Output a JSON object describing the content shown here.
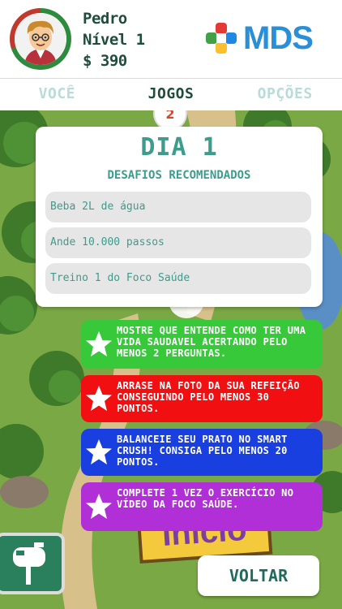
{
  "user": {
    "name": "Pedro",
    "level": "Nível 1",
    "money": "$ 390"
  },
  "brand": {
    "logo_text": "MDS"
  },
  "tabs": [
    {
      "label": "VOCÊ",
      "active": false
    },
    {
      "label": "JOGOS",
      "active": true
    },
    {
      "label": "OPÇÕES",
      "active": false
    }
  ],
  "day_card": {
    "title": "DIA 1",
    "subtitle": "DESAFIOS RECOMENDADOS",
    "challenges": [
      "Beba 2L de água",
      "Ande 10.000 passos",
      "Treino 1 do Foco Saúde"
    ]
  },
  "tasks": [
    {
      "text": "MOSTRE QUE ENTENDE COMO TER UMA VIDA SAUDAVEL ACERTANDO PELO MENOS 2 PERGUNTAS.",
      "color": "#37c93a"
    },
    {
      "text": "ARRASE NA FOTO DA SUA REFEIÇÃO CONSEGUINDO PELO MENOS 30 PONTOS.",
      "color": "#f20f12"
    },
    {
      "text": "BALANCEIE SEU PRATO NO SMART CRUSH! CONSIGA PELO MENOS 20 PONTOS.",
      "color": "#1a3fe0"
    },
    {
      "text": "COMPLETE 1 VEZ O EXERCÍCIO NO VÍDEO DA FOCO SAÚDE.",
      "color": "#b02fd6"
    }
  ],
  "map": {
    "sign_text": "Início"
  },
  "buttons": {
    "back": "VOLTAR"
  },
  "icons": {
    "mailbox": "mailbox-icon",
    "star": "star-icon"
  }
}
